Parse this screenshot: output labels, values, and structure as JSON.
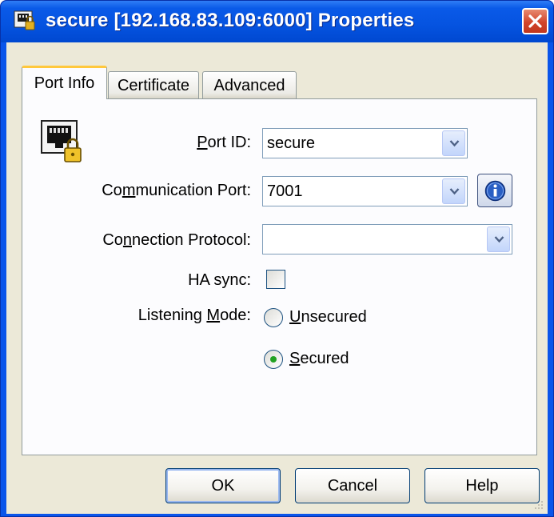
{
  "window": {
    "title": "secure [192.168.83.109:6000] Properties",
    "icon": "network-port-lock-icon",
    "close_icon": "close-icon"
  },
  "tabs": [
    {
      "label": "Port Info",
      "active": true
    },
    {
      "label": "Certificate",
      "active": false
    },
    {
      "label": "Advanced",
      "active": false
    }
  ],
  "port_info": {
    "port_icon": "network-port-lock-icon",
    "port_id": {
      "label_pre": "",
      "label_acc": "P",
      "label_post": "ort ID:",
      "value": "secure"
    },
    "communication_port": {
      "label_pre": "Co",
      "label_acc": "m",
      "label_post": "munication Port:",
      "value": "7001"
    },
    "connection_protocol": {
      "label_pre": "Co",
      "label_acc": "n",
      "label_post": "nection Protocol:",
      "value": ""
    },
    "ha_sync": {
      "label": "HA sync:",
      "checked": false
    },
    "listening_mode": {
      "label_pre": "Listening ",
      "label_acc": "M",
      "label_post": "ode:",
      "options": [
        {
          "label_pre": "",
          "label_acc": "U",
          "label_post": "nsecured",
          "selected": false
        },
        {
          "label_pre": "",
          "label_acc": "S",
          "label_post": "ecured",
          "selected": true
        }
      ]
    },
    "info_icon": "info-icon"
  },
  "buttons": {
    "ok": "OK",
    "cancel": "Cancel",
    "help": "Help"
  },
  "colors": {
    "titlebar": "#0553e0",
    "dialog_bg": "#ece9d8",
    "active_tab_accent": "#ffc83c",
    "radio_dot": "#21a121"
  }
}
